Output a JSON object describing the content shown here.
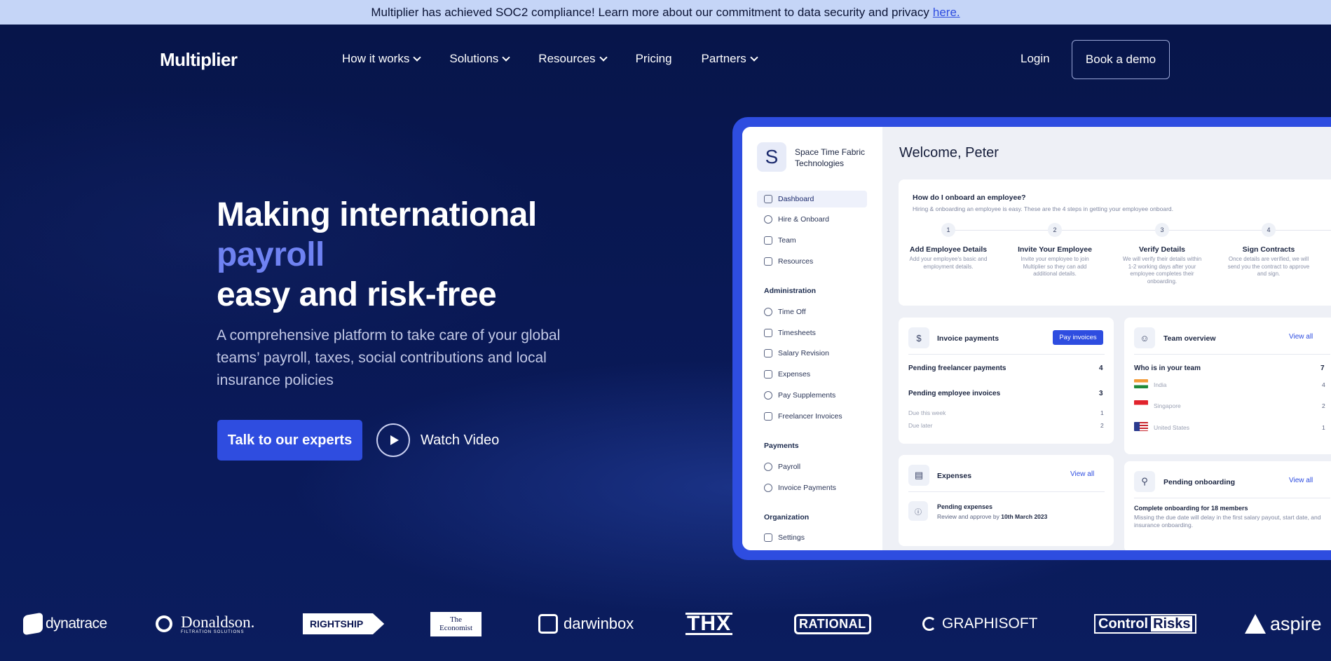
{
  "banner": {
    "text": "Multiplier has achieved SOC2 compliance! Learn more about our commitment to data security and privacy",
    "link": "here."
  },
  "nav": {
    "logo": "Multiplier",
    "items": [
      {
        "label": "How it works",
        "dropdown": true
      },
      {
        "label": "Solutions",
        "dropdown": true
      },
      {
        "label": "Resources",
        "dropdown": true
      },
      {
        "label": "Pricing",
        "dropdown": false
      },
      {
        "label": "Partners",
        "dropdown": true
      }
    ],
    "login": "Login",
    "demo": "Book a demo"
  },
  "hero": {
    "line1": "Making international",
    "line2": "payroll",
    "line3": "easy and risk-free",
    "subtitle": "A comprehensive platform to take care of your global teams’ payroll, taxes, social contributions and local insurance policies",
    "cta": "Talk to our experts",
    "watch": "Watch Video"
  },
  "dashboard": {
    "org_initial": "S",
    "org_name": "Space Time Fabric Technologies",
    "welcome": "Welcome, Peter",
    "sidebar": {
      "main": [
        "Dashboard",
        "Hire & Onboard",
        "Team",
        "Resources"
      ],
      "admin_head": "Administration",
      "admin": [
        "Time Off",
        "Timesheets",
        "Salary Revision",
        "Expenses",
        "Pay Supplements",
        "Freelancer Invoices"
      ],
      "payments_head": "Payments",
      "payments": [
        "Payroll",
        "Invoice Payments"
      ],
      "org_head": "Organization",
      "org": [
        "Settings"
      ]
    },
    "onboard": {
      "title": "How do I onboard an employee?",
      "desc": "Hiring & onboarding an employee is easy. These are the 4 steps in getting your employee onboard.",
      "steps": [
        {
          "num": "1",
          "title": "Add Employee Details",
          "desc": "Add your employee's basic and employment details."
        },
        {
          "num": "2",
          "title": "Invite Your Employee",
          "desc": "Invite your employee to join Multiplier so they can add additional details."
        },
        {
          "num": "3",
          "title": "Verify Details",
          "desc": "We will verify their details within 1-2 working days after your employee completes their onboarding."
        },
        {
          "num": "4",
          "title": "Sign Contracts",
          "desc": "Once details are verified, we will send you the contract to approve and sign."
        }
      ]
    },
    "invoice": {
      "title": "Invoice payments",
      "button": "Pay invoices",
      "freelancer_label": "Pending freelancer payments",
      "freelancer_val": "4",
      "employee_label": "Pending employee invoices",
      "employee_val": "3",
      "due_week_label": "Due this week",
      "due_week_val": "1",
      "due_later_label": "Due later",
      "due_later_val": "2"
    },
    "team": {
      "title": "Team overview",
      "link": "View all",
      "who_label": "Who is in your team",
      "who_val": "7",
      "countries": [
        {
          "name": "India",
          "count": "4"
        },
        {
          "name": "Singapore",
          "count": "2"
        },
        {
          "name": "United States",
          "count": "1"
        }
      ]
    },
    "expenses": {
      "title": "Expenses",
      "link": "View all",
      "pending_title": "Pending expenses",
      "pending_desc": "Review and approve by",
      "pending_date": "10th March 2023"
    },
    "onboarding": {
      "title": "Pending onboarding",
      "link": "View all",
      "headline": "Complete onboarding for 18 members",
      "desc": "Missing the due date will delay in the first salary payout, start date, and insurance onboarding."
    }
  },
  "logos": {
    "dynatrace": "dynatrace",
    "donaldson": "Donaldson.",
    "donaldson_sub": "FILTRATION SOLUTIONS",
    "rightship": "RIGHTSHIP",
    "economist_1": "The",
    "economist_2": "Economist",
    "darwinbox": "darwinbox",
    "thx": "THX",
    "rational": "RATIONAL",
    "graphisoft": "GRAPHISOFT",
    "control": "Control",
    "risks": "Risks",
    "aspire": "aspire"
  }
}
